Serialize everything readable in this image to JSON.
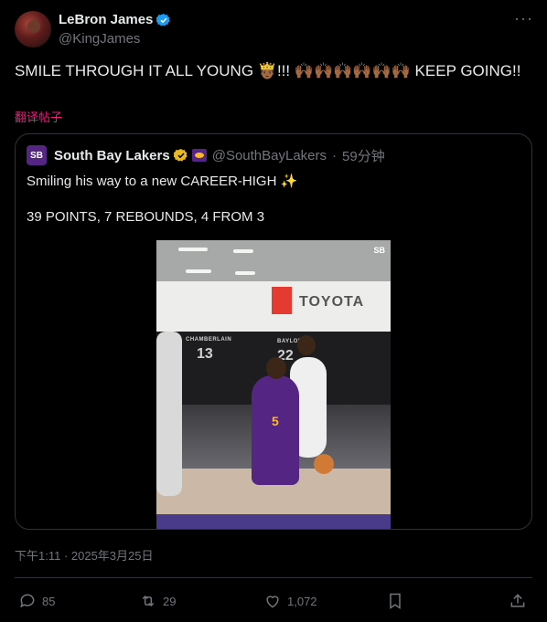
{
  "author": {
    "display_name": "LeBron James",
    "handle": "@KingJames",
    "verified_color": "#1d9bf0"
  },
  "tweet": {
    "text": "SMILE THROUGH IT ALL YOUNG 🤴🏾!!! 🙌🏾🙌🏾🙌🏾🙌🏾🙌🏾🙌🏾 KEEP GOING!!",
    "translate_label": "翻译帖子",
    "translate_color": "#f91880"
  },
  "quote": {
    "logo_text": "SB",
    "display_name": "South Bay Lakers",
    "handle": "@SouthBayLakers",
    "separator": "·",
    "time_ago": "59分钟",
    "line1": "Smiling his way to a new CAREER-HIGH ✨",
    "line2": "39 POINTS, 7 REBOUNDS, 4 FROM 3",
    "media": {
      "sponsor": "TOYOTA",
      "jersey1_label": "CHAMBERLAIN",
      "jersey1_number": "13",
      "jersey2_label": "BAYLOR",
      "jersey2_number": "22",
      "player_number": "5",
      "badge": "SB"
    }
  },
  "meta": {
    "timestamp": "下午1:11 · 2025年3月25日"
  },
  "actions": {
    "replies": "85",
    "reposts": "29",
    "likes": "1,072"
  }
}
